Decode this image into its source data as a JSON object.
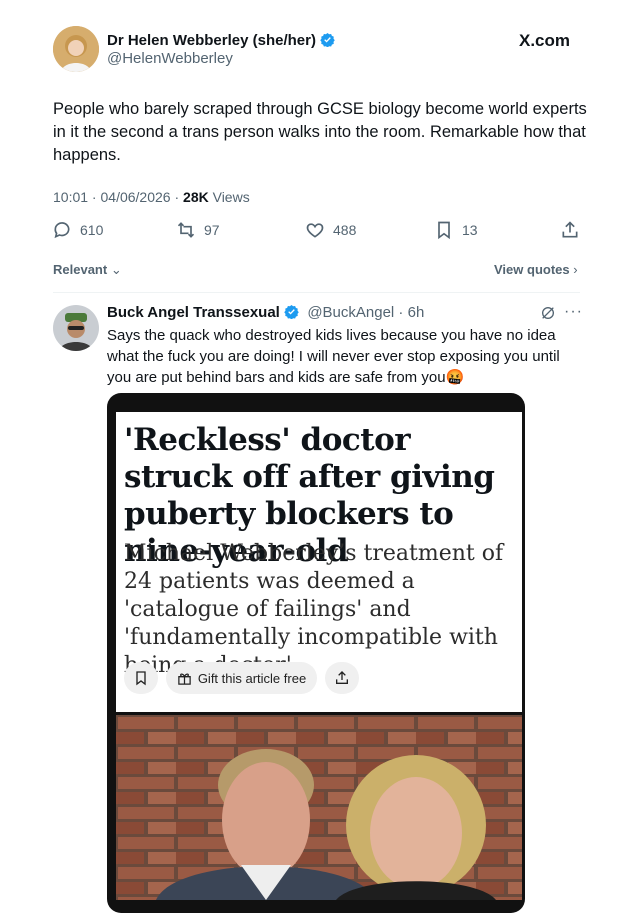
{
  "tweet": {
    "author_name": "Dr Helen Webberley (she/her)",
    "author_handle": "@HelenWebberley",
    "source": "X.com",
    "text": "People who barely scraped through GCSE biology become world experts in it the second a trans person walks into the room. Remarkable how that happens.",
    "time": "10:01",
    "date": "04/06/2026",
    "views_count": "28K",
    "views_label": "Views",
    "replies": "610",
    "reposts": "97",
    "likes": "488",
    "bookmarks": "13"
  },
  "filters": {
    "sort_label": "Relevant",
    "quotes_label": "View quotes"
  },
  "reply": {
    "author_name": "Buck Angel Transsexual",
    "author_handle": "@BuckAngel",
    "time_ago": "6h",
    "text": "Says the quack who destroyed kids lives because you have no idea what the fuck you are doing! I will never ever stop exposing you until you are put behind bars and kids are safe from you🤬",
    "article": {
      "headline": "'Reckless' doctor struck off after giving puberty blockers to nine-year-old",
      "standfirst": "Michael Webberley’s treatment of 24 patients was deemed a 'catalogue of failings' and 'fundamentally incompatible with being a doctor'",
      "gift_label": "Gift this article free"
    }
  },
  "colors": {
    "verified_blue": "#1d9bf0",
    "secondary_text": "#536471",
    "brick": "#8a4a36"
  }
}
